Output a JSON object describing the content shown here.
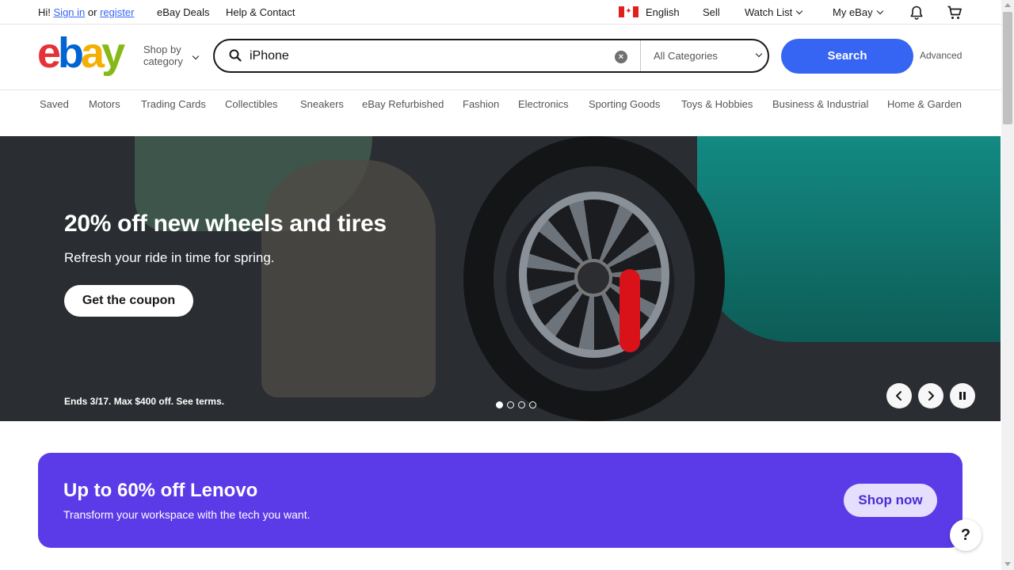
{
  "topbar": {
    "greeting": "Hi!",
    "sign_in": "Sign in",
    "or": "or",
    "register": "register",
    "deals": "eBay Deals",
    "help": "Help & Contact",
    "language": "English",
    "sell": "Sell",
    "watchlist": "Watch List",
    "myebay": "My eBay"
  },
  "header": {
    "logo": [
      "e",
      "b",
      "a",
      "y"
    ],
    "shop_by_line1": "Shop by",
    "shop_by_line2": "category",
    "search_value": "iPhone",
    "category": "All Categories",
    "search_button": "Search",
    "advanced": "Advanced"
  },
  "nav": [
    "Saved",
    "Motors",
    "Trading Cards",
    "Collectibles",
    "Sneakers",
    "eBay Refurbished",
    "Fashion",
    "Electronics",
    "Sporting Goods",
    "Toys & Hobbies",
    "Business & Industrial",
    "Home & Garden"
  ],
  "hero": {
    "title": "20% off new wheels and tires",
    "subtitle": "Refresh your ride in time for spring.",
    "button": "Get the coupon",
    "terms": "Ends 3/17. Max $400 off. See terms.",
    "slides": 4,
    "active_slide": 1
  },
  "promo": {
    "title": "Up to 60% off Lenovo",
    "subtitle": "Transform your workspace with the tech you want.",
    "button": "Shop now"
  },
  "help": "?",
  "colors": {
    "brand_blue": "#3665f3",
    "promo_purple": "#5b3be8",
    "logo_red": "#e53238",
    "logo_blue": "#0064d2",
    "logo_yellow": "#f5af02",
    "logo_green": "#86b817"
  }
}
